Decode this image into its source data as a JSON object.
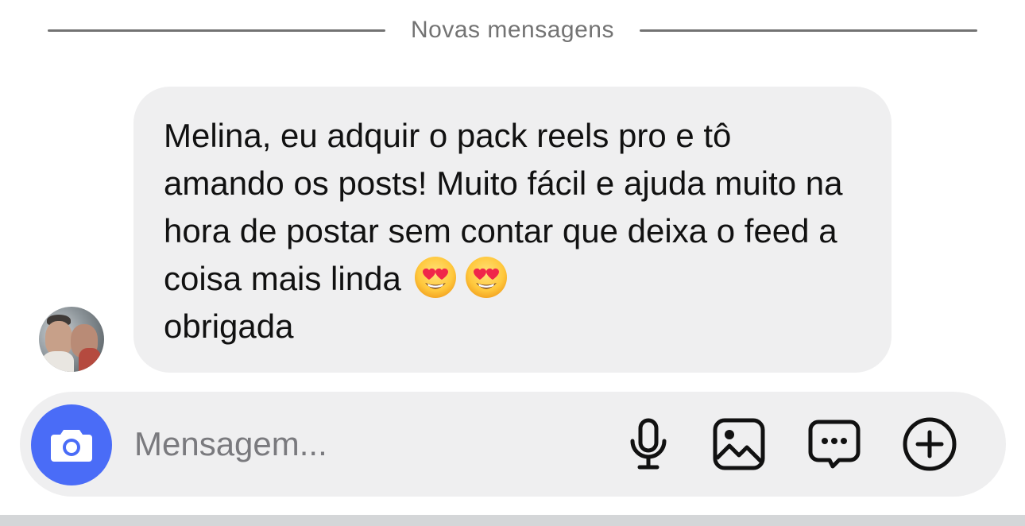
{
  "divider": {
    "label": "Novas mensagens"
  },
  "message": {
    "text_before_emoji": "Melina, eu adquir o pack reels pro e tô amando os posts! Muito fácil e ajuda muito na hora de postar sem contar que deixa o feed a coisa mais linda",
    "emojis": [
      "😍",
      "😍"
    ],
    "text_after_emoji": "obrigada"
  },
  "composer": {
    "placeholder": "Mensagem...",
    "value": ""
  },
  "icons": {
    "camera": "camera-icon",
    "microphone": "microphone-icon",
    "image": "image-icon",
    "sticker": "sticker-icon",
    "add": "plus-icon"
  },
  "colors": {
    "accent": "#4a6cf7",
    "bubble": "#efeff0",
    "divider": "#737373",
    "placeholder": "#7a7a7e"
  }
}
